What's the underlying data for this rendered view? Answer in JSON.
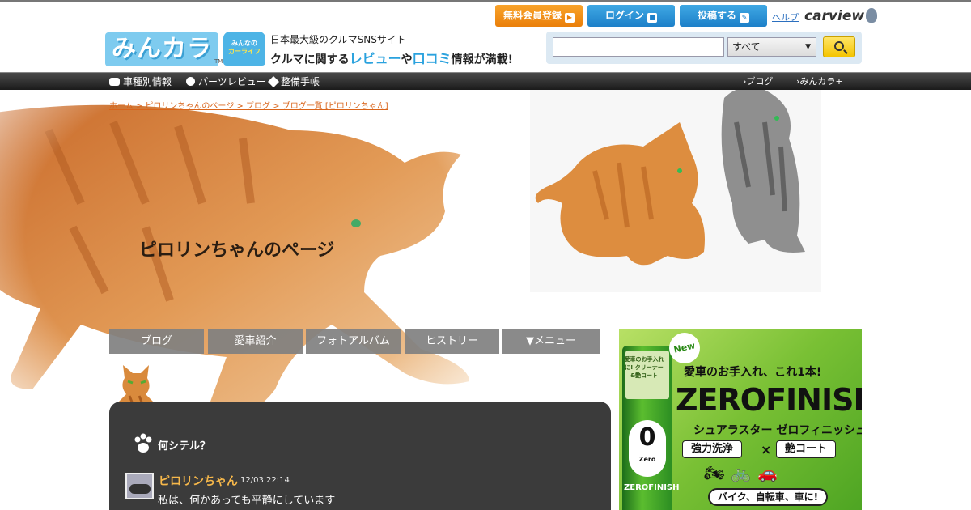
{
  "header": {
    "logo_text": "みんカラ",
    "logo_tm": "TM",
    "badge_line1": "みんなの",
    "badge_line2": "カーライフ",
    "tagline1": "日本最大級のクルマSNSサイト",
    "tagline2_pre": "クルマに関する",
    "tagline2_hl1": "レビュー",
    "tagline2_mid": "や",
    "tagline2_hl2": "口コミ",
    "tagline2_post": "情報が満載!",
    "register_label": "無料会員登録",
    "login_label": "ログイン",
    "post_label": "投稿する",
    "help_label": "ヘルプ",
    "carview_label": "carview",
    "search": {
      "placeholder": "",
      "select_value": "すべて"
    }
  },
  "nav": {
    "items": [
      "車種別情報",
      "パーツレビュー",
      "整備手帳"
    ],
    "right_items": [
      "ブログ",
      "みんカラ+"
    ]
  },
  "hero": {
    "breadcrumb": "ホーム > ピロリンちゃんのページ > ブログ > ブログ一覧 [ピロリンちゃん]",
    "page_title": "ピロリンちゃんのページ"
  },
  "tabs": [
    "ブログ",
    "愛車紹介",
    "フォトアルバム",
    "ヒストリー",
    "▼メニュー"
  ],
  "panel": {
    "heading": "何シテル？",
    "post": {
      "user": "ピロリンちゃん",
      "time": "12/03 22:14",
      "text": "私は、何かあっても平静にしています"
    }
  },
  "ad": {
    "new_label": "New",
    "headline": "愛車のお手入れ、これ1本!",
    "brand": "ZEROFINISH",
    "sub": "シュアラスター ゼロフィニッシュ",
    "pill1": "強力洗浄",
    "x": "×",
    "pill2": "艶コート",
    "icons": "🏍🚲🚗",
    "tag": "バイク、自転車、車に!",
    "can_cap": "愛車のお手入れに! クリーナー&艶コート",
    "can_zero": "0",
    "can_zero_label": "Zero",
    "can_brand": "ZEROFINISH"
  }
}
